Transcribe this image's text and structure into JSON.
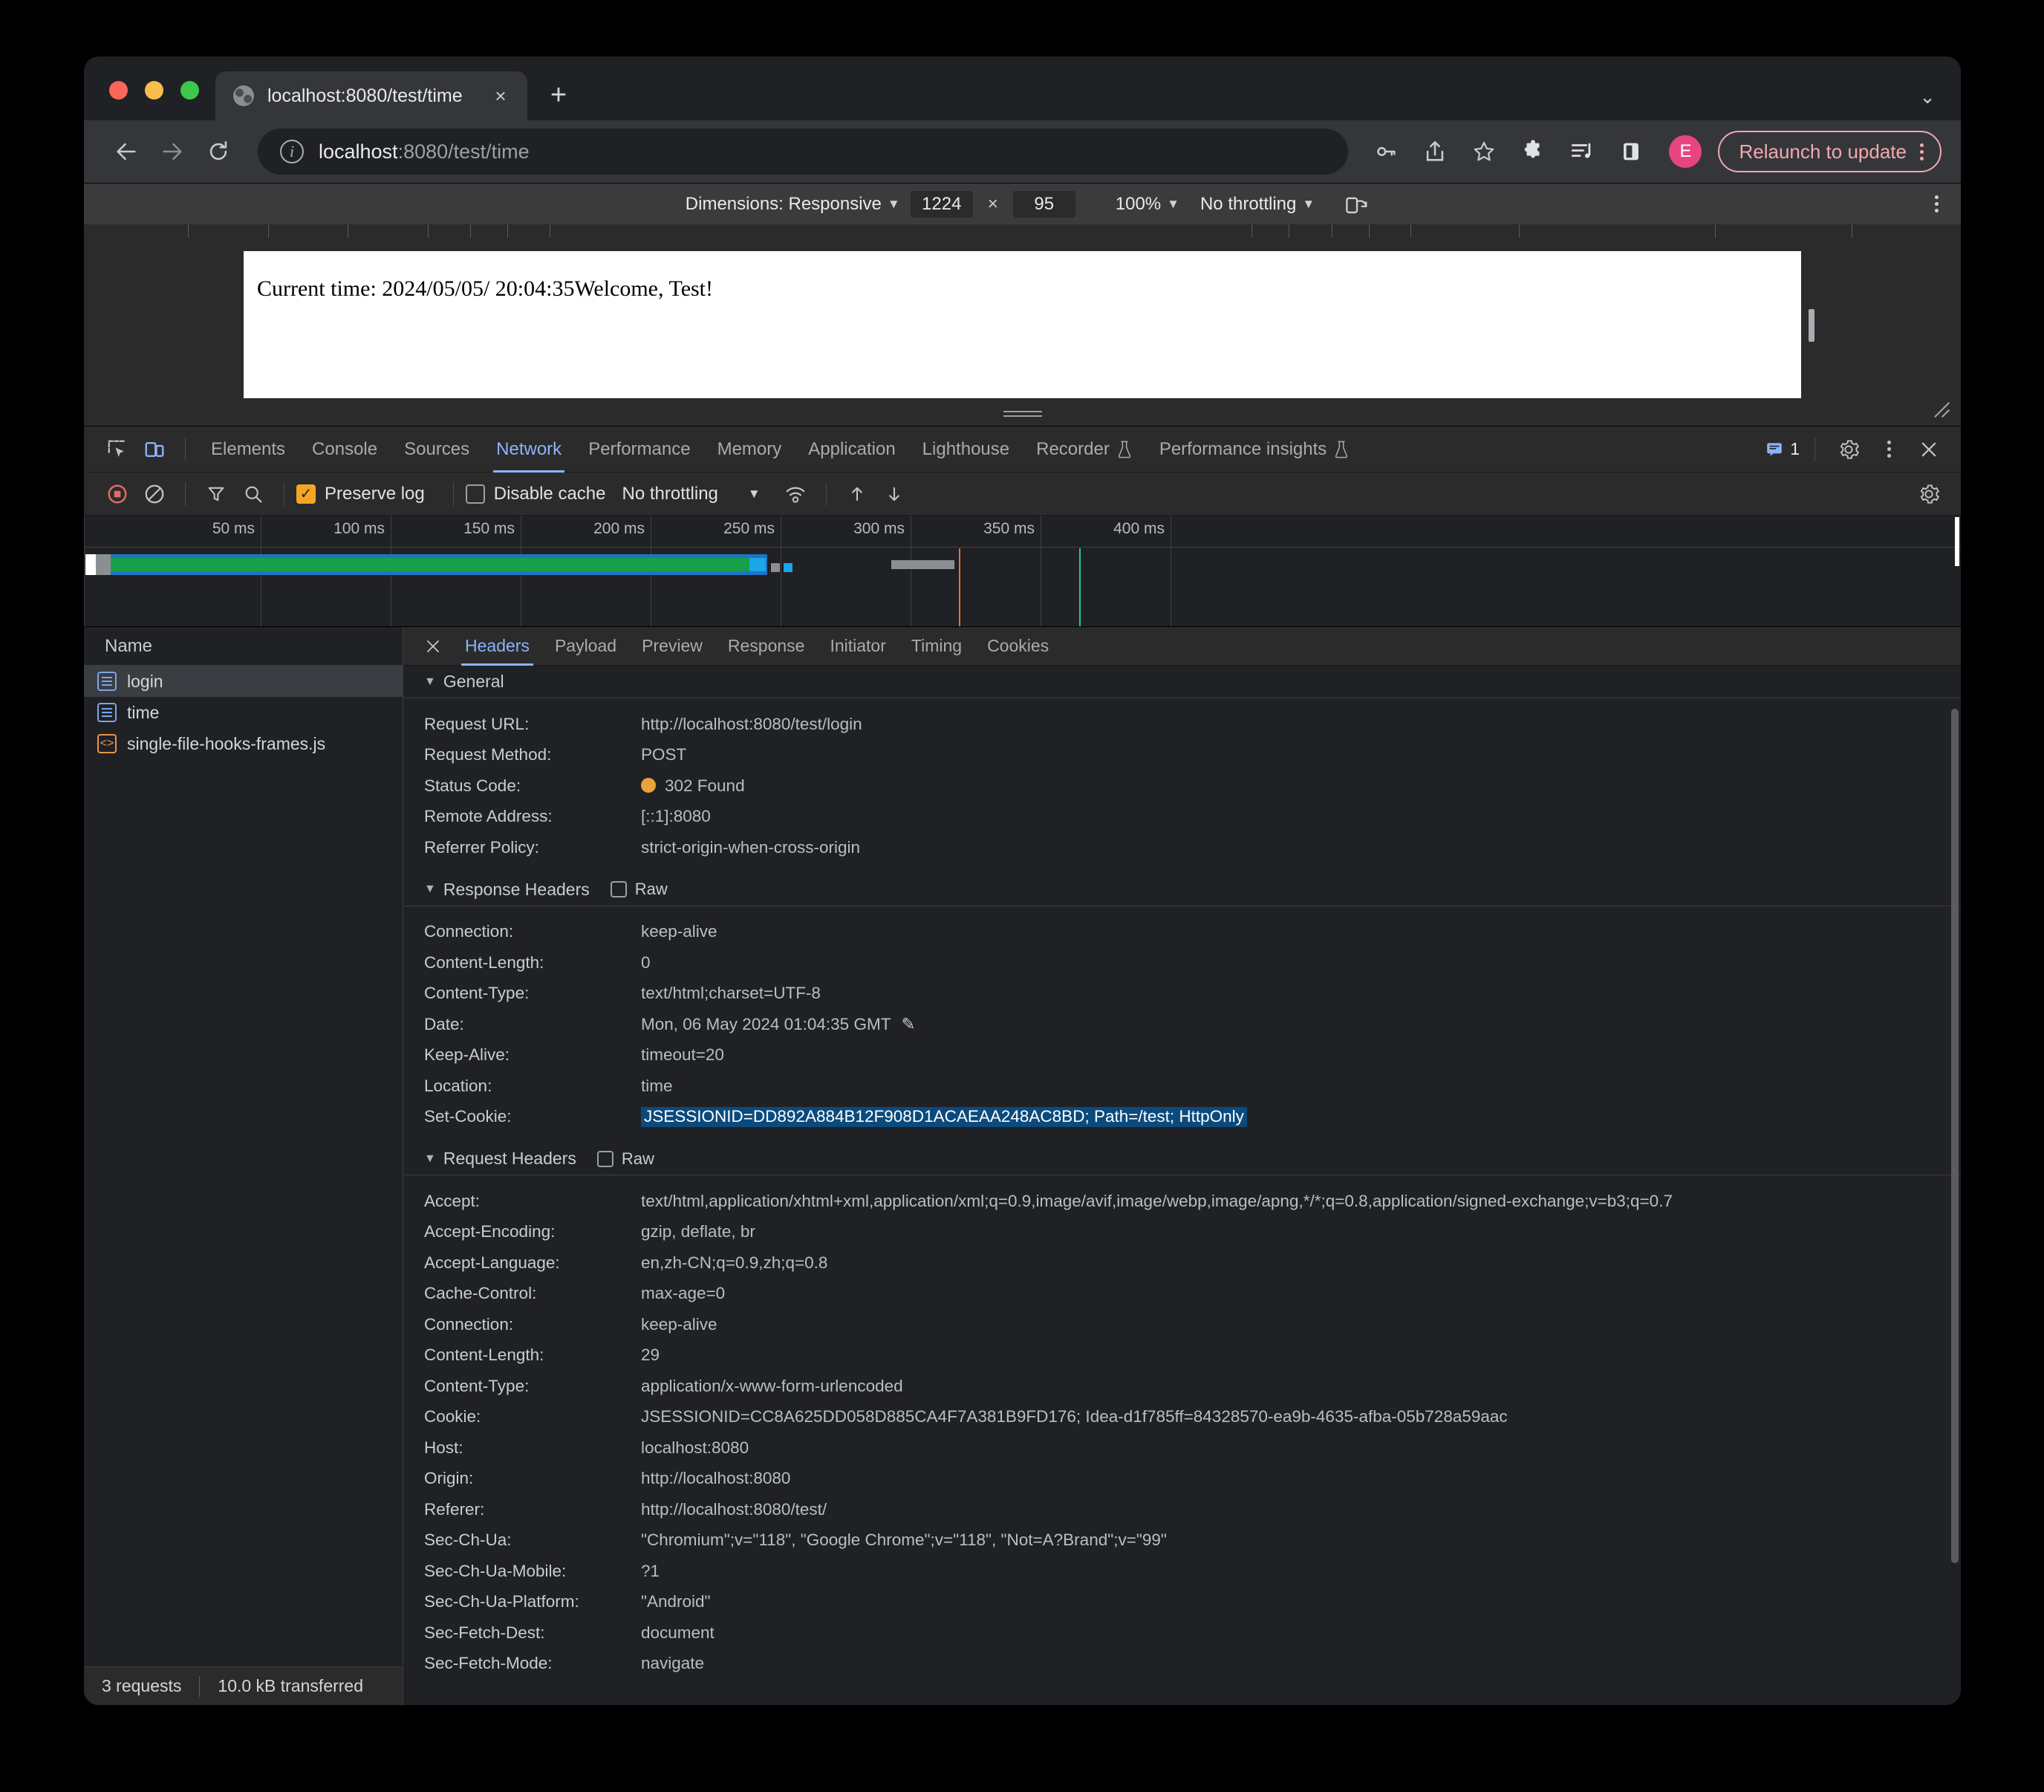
{
  "browser": {
    "tab": {
      "title": "localhost:8080/test/time",
      "favicon": "globe-icon",
      "close": "×"
    },
    "new_tab": "+",
    "tabstrip_chevron": "⌄",
    "omnibox": {
      "host": "localhost",
      "rest": ":8080/test/time"
    },
    "relaunch_label": "Relaunch to update",
    "avatar_initial": "E"
  },
  "device_toolbar": {
    "dimensions_label": "Dimensions: Responsive",
    "width": "1224",
    "x_label": "×",
    "height": "95",
    "zoom": "100%",
    "throttling": "No throttling"
  },
  "page": {
    "content": "Current time: 2024/05/05/ 20:04:35Welcome, Test!"
  },
  "devtools": {
    "tabs": [
      {
        "label": "Elements",
        "active": false
      },
      {
        "label": "Console",
        "active": false
      },
      {
        "label": "Sources",
        "active": false
      },
      {
        "label": "Network",
        "active": true
      },
      {
        "label": "Performance",
        "active": false
      },
      {
        "label": "Memory",
        "active": false
      },
      {
        "label": "Application",
        "active": false
      },
      {
        "label": "Lighthouse",
        "active": false
      },
      {
        "label": "Recorder",
        "active": false,
        "beaker": true
      },
      {
        "label": "Performance insights",
        "active": false,
        "beaker": true
      }
    ],
    "message_count": "1",
    "network_toolbar": {
      "preserve_log": "Preserve log",
      "preserve_log_checked": true,
      "disable_cache": "Disable cache",
      "disable_cache_checked": false,
      "throttling": "No throttling"
    },
    "overview": {
      "ticks": [
        "50 ms",
        "100 ms",
        "150 ms",
        "200 ms",
        "250 ms",
        "300 ms",
        "350 ms",
        "400 ms"
      ]
    },
    "request_list": {
      "column_header": "Name",
      "rows": [
        {
          "name": "login",
          "icon": "document-icon",
          "selected": true
        },
        {
          "name": "time",
          "icon": "document-icon",
          "selected": false
        },
        {
          "name": "single-file-hooks-frames.js",
          "icon": "script-icon",
          "selected": false
        }
      ],
      "footer": {
        "requests": "3 requests",
        "transferred": "10.0 kB transferred"
      }
    },
    "detail_tabs": [
      {
        "label": "Headers",
        "active": true
      },
      {
        "label": "Payload",
        "active": false
      },
      {
        "label": "Preview",
        "active": false
      },
      {
        "label": "Response",
        "active": false
      },
      {
        "label": "Initiator",
        "active": false
      },
      {
        "label": "Timing",
        "active": false
      },
      {
        "label": "Cookies",
        "active": false
      }
    ],
    "sections": {
      "general": {
        "title": "General",
        "rows": [
          {
            "name": "Request URL:",
            "value": "http://localhost:8080/test/login"
          },
          {
            "name": "Request Method:",
            "value": "POST"
          },
          {
            "name": "Status Code:",
            "value": "302 Found",
            "status_dot": true
          },
          {
            "name": "Remote Address:",
            "value": "[::1]:8080"
          },
          {
            "name": "Referrer Policy:",
            "value": "strict-origin-when-cross-origin"
          }
        ]
      },
      "response_headers": {
        "title": "Response Headers",
        "raw_label": "Raw",
        "rows": [
          {
            "name": "Connection:",
            "value": "keep-alive"
          },
          {
            "name": "Content-Length:",
            "value": "0"
          },
          {
            "name": "Content-Type:",
            "value": "text/html;charset=UTF-8"
          },
          {
            "name": "Date:",
            "value": "Mon, 06 May 2024 01:04:35 GMT",
            "editable": true
          },
          {
            "name": "Keep-Alive:",
            "value": "timeout=20"
          },
          {
            "name": "Location:",
            "value": "time"
          },
          {
            "name": "Set-Cookie:",
            "value": "JSESSIONID=DD892A884B12F908D1ACAEAA248AC8BD; Path=/test; HttpOnly",
            "selected": true
          }
        ]
      },
      "request_headers": {
        "title": "Request Headers",
        "raw_label": "Raw",
        "rows": [
          {
            "name": "Accept:",
            "value": "text/html,application/xhtml+xml,application/xml;q=0.9,image/avif,image/webp,image/apng,*/*;q=0.8,application/signed-exchange;v=b3;q=0.7"
          },
          {
            "name": "Accept-Encoding:",
            "value": "gzip, deflate, br"
          },
          {
            "name": "Accept-Language:",
            "value": "en,zh-CN;q=0.9,zh;q=0.8"
          },
          {
            "name": "Cache-Control:",
            "value": "max-age=0"
          },
          {
            "name": "Connection:",
            "value": "keep-alive"
          },
          {
            "name": "Content-Length:",
            "value": "29"
          },
          {
            "name": "Content-Type:",
            "value": "application/x-www-form-urlencoded"
          },
          {
            "name": "Cookie:",
            "value": "JSESSIONID=CC8A625DD058D885CA4F7A381B9FD176; Idea-d1f785ff=84328570-ea9b-4635-afba-05b728a59aac"
          },
          {
            "name": "Host:",
            "value": "localhost:8080"
          },
          {
            "name": "Origin:",
            "value": "http://localhost:8080"
          },
          {
            "name": "Referer:",
            "value": "http://localhost:8080/test/"
          },
          {
            "name": "Sec-Ch-Ua:",
            "value": "\"Chromium\";v=\"118\", \"Google Chrome\";v=\"118\", \"Not=A?Brand\";v=\"99\""
          },
          {
            "name": "Sec-Ch-Ua-Mobile:",
            "value": "?1"
          },
          {
            "name": "Sec-Ch-Ua-Platform:",
            "value": "\"Android\""
          },
          {
            "name": "Sec-Fetch-Dest:",
            "value": "document"
          },
          {
            "name": "Sec-Fetch-Mode:",
            "value": "navigate"
          }
        ]
      }
    }
  },
  "colors": {
    "accent": "#8ab4f8",
    "status_302": "#e8a33d",
    "selection": "#0b4a7d",
    "relaunch": "#f4a8ae"
  }
}
